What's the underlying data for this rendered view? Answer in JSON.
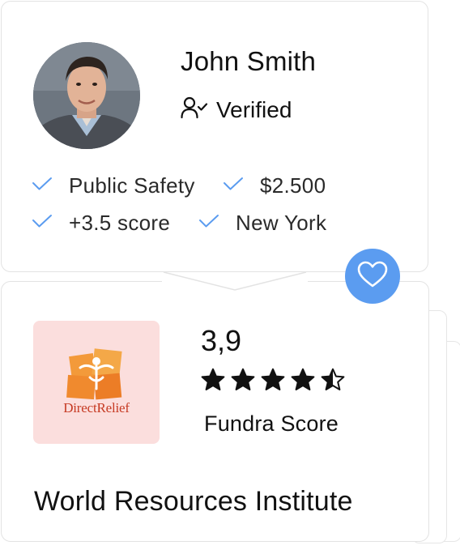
{
  "profile": {
    "name": "John Smith",
    "verified_label": "Verified",
    "tags": [
      {
        "label": "Public Safety"
      },
      {
        "label": "$2.500"
      },
      {
        "label": "+3.5 score"
      },
      {
        "label": "New York"
      }
    ]
  },
  "organization": {
    "logo_text": "DirectRelief",
    "score": "3,9",
    "rating": 4.5,
    "rating_max": 5,
    "score_label": "Fundra Score",
    "name": "World Resources Institute"
  },
  "icons": {
    "verified": "user-check-icon",
    "tag_check": "check-icon",
    "favorite": "heart-icon"
  },
  "colors": {
    "accent": "#5b9cf0",
    "check": "#5b9cf0",
    "logo_bg": "#fbdedd",
    "logo_orange": "#f08a2e",
    "logo_text": "#c63a23"
  }
}
